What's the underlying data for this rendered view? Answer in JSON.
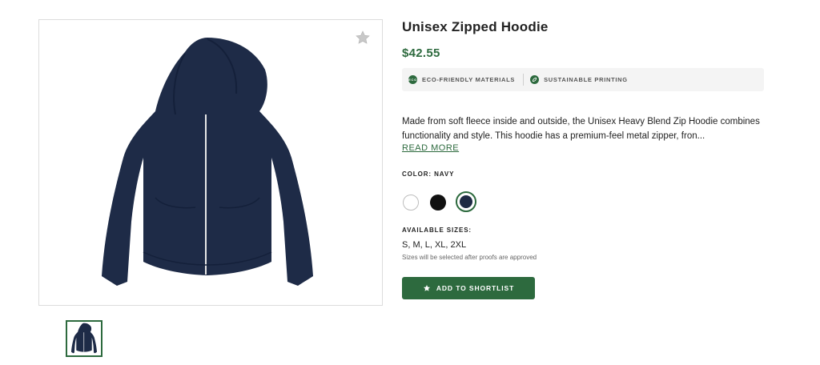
{
  "product": {
    "title": "Unisex Zipped Hoodie",
    "price": "$42.55",
    "badges": [
      {
        "label": "ECO-FRIENDLY MATERIALS",
        "icon": "eco-icon",
        "icon_text": "ECO"
      },
      {
        "label": "SUSTAINABLE PRINTING",
        "icon": "leaf-icon"
      }
    ],
    "description": "Made from soft fleece inside and outside, the Unisex Heavy Blend Zip Hoodie combines functionality and style. This hoodie has a premium-feel metal zipper, fron...",
    "read_more": "READ MORE",
    "color_label": "COLOR: NAVY",
    "colors": [
      {
        "name": "White",
        "hex": "#ffffff",
        "selected": false
      },
      {
        "name": "Black",
        "hex": "#111111",
        "selected": false
      },
      {
        "name": "Navy",
        "hex": "#1f2a44",
        "selected": true
      }
    ],
    "sizes_label": "AVAILABLE SIZES:",
    "sizes": "S, M, L, XL, 2XL",
    "sizes_note": "Sizes will be selected after proofs are approved",
    "cta_label": "ADD TO SHORTLIST",
    "accent_color": "#2d6a3e"
  }
}
